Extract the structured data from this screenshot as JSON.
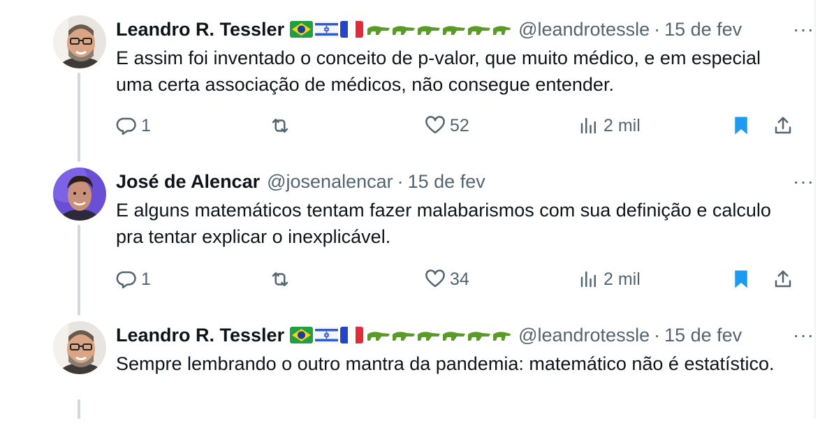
{
  "tweets": [
    {
      "author": "Leandro R. Tessler",
      "flags": [
        "brazil-flag",
        "israel-flag",
        "france-flag"
      ],
      "emoji_suffix": "crocodile-emojis",
      "handle": "@leandrotessle",
      "separator": "·",
      "date": "15 de fev",
      "more": "···",
      "text": "E assim foi inventado o conceito de p-valor, que muito médico, e em especial uma certa associação de médicos, não consegue entender.",
      "replies": "1",
      "likes": "52",
      "views": "2 mil"
    },
    {
      "author": "José de Alencar",
      "handle": "@josenalencar",
      "separator": "·",
      "date": "15 de fev",
      "more": "···",
      "text": "E alguns matemáticos tentam fazer malabarismos com sua definição e calculo pra tentar explicar o inexplicável.",
      "replies": "1",
      "likes": "34",
      "views": "2 mil"
    },
    {
      "author": "Leandro R. Tessler",
      "flags": [
        "brazil-flag",
        "israel-flag",
        "france-flag"
      ],
      "emoji_suffix": "crocodile-emojis",
      "handle": "@leandrotessle",
      "separator": "·",
      "date": "15 de fev",
      "more": "···",
      "text": "Sempre lembrando o outro mantra da pandemia: matemático não é estatístico."
    }
  ],
  "colors": {
    "text": "#0f1419",
    "secondary": "#536471",
    "bookmark_active": "#1d9bf0",
    "thread_line": "#cfd9de"
  }
}
